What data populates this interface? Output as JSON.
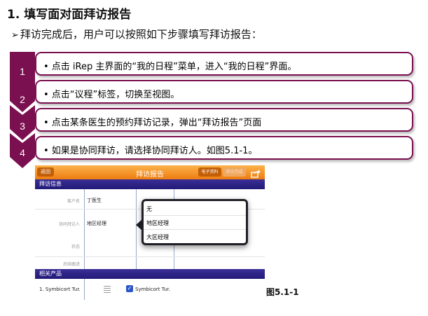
{
  "heading": "1. 填写面对面拜访报告",
  "intro": {
    "arrow": "➢",
    "text": "拜访完成后，用户可以按照如下步骤填写拜访报告："
  },
  "accent_color": "#7b1050",
  "steps": [
    {
      "num": "1",
      "text": "• 点击 iRep 主界面的“我的日程”菜单，进入“我的日程”界面。"
    },
    {
      "num": "2",
      "text": "• 点击“议程”标签，切换至视图。"
    },
    {
      "num": "3",
      "text": "• 点击某条医生的预约拜访记录，弹出“拜访报告”页面"
    },
    {
      "num": "4",
      "text": "• 如果是协同拜访，请选择协同拜访人。如图5.1-1。"
    }
  ],
  "screenshot": {
    "toolbar": {
      "back": "返回",
      "title": "拜访报告",
      "ebook": "电子资料",
      "complete": "拜访完成",
      "share_icon": "share-icon"
    },
    "section_visit_info": "拜访信息",
    "fields": {
      "customer_label": "客户名",
      "customer_value": "丁医生",
      "cobuddy_label": "协同拜访人",
      "cobuddy_value": "地区经理",
      "status_label": "状态",
      "followup_label": "后续跟进"
    },
    "popover_options": [
      "无",
      "地区经理",
      "大区经理"
    ],
    "section_related": "相关产品",
    "product_left": "1.  Symbicort Tur.",
    "product_right": "Symbicort Tur.",
    "colors": {
      "toolbar": "#f39a2e",
      "section": "#2d2388",
      "checkbox": "#2c57c9"
    }
  },
  "caption": "图5.1-1"
}
